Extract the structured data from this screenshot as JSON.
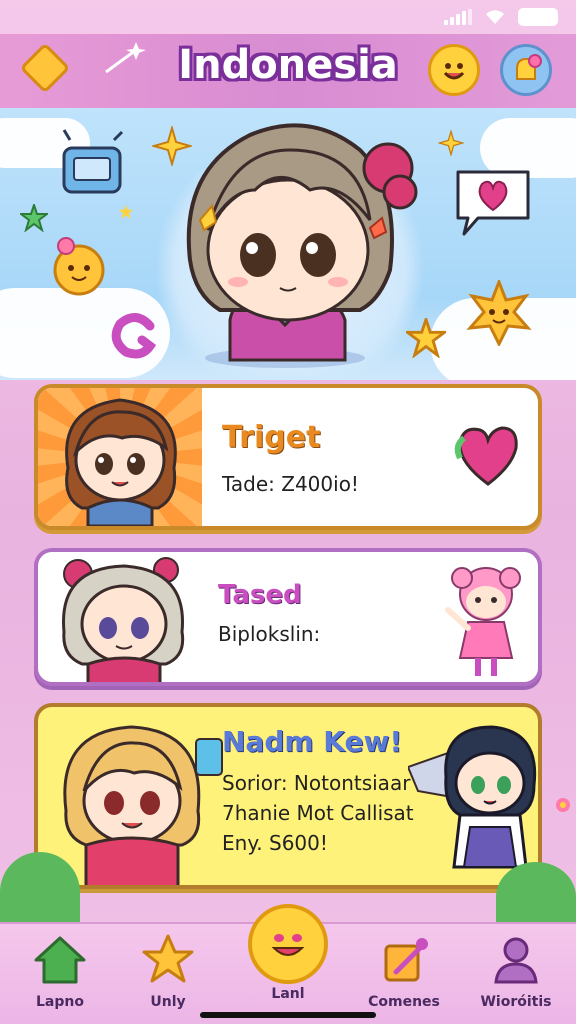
{
  "header": {
    "title": "Indonesia"
  },
  "cards": [
    {
      "title": "Triget",
      "text": "Tade: Z400io!"
    },
    {
      "title": "Tased",
      "text": "Biplokslin:"
    },
    {
      "title": "Nadm Kew!",
      "lines": [
        "Sorior: Notontsiaar",
        "7hanie Mot Callisat",
        "Eny.  S600!"
      ]
    }
  ],
  "bottom_nav": {
    "items": [
      {
        "label": "Lapno",
        "icon": "home-icon"
      },
      {
        "label": "Unly",
        "icon": "star-icon"
      },
      {
        "label": "Lanl",
        "icon": "smiley-icon",
        "active": true
      },
      {
        "label": "Comenes",
        "icon": "edit-icon"
      },
      {
        "label": "Wioróitis",
        "icon": "profile-icon"
      }
    ]
  },
  "colors": {
    "accent": "#d88cd2",
    "title_outline": "#7a2f9a",
    "gold": "#ffd23d"
  }
}
